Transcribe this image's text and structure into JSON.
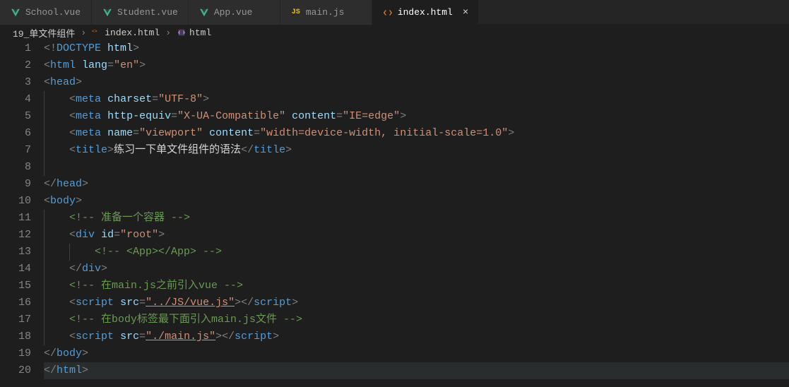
{
  "tabs": [
    {
      "label": "School.vue",
      "icon": "vue",
      "active": false
    },
    {
      "label": "Student.vue",
      "icon": "vue",
      "active": false
    },
    {
      "label": "App.vue",
      "icon": "vue",
      "active": false
    },
    {
      "label": "main.js",
      "icon": "js",
      "active": false
    },
    {
      "label": "index.html",
      "icon": "html",
      "active": true
    }
  ],
  "breadcrumb": {
    "folder": "19_单文件组件",
    "file": "index.html",
    "symbol": "html"
  },
  "close_label": "×",
  "icon_text": {
    "js": "JS"
  },
  "gutter_max": 20,
  "code_tokens": [
    [
      [
        "punct",
        "<!"
      ],
      [
        "tag",
        "DOCTYPE"
      ],
      [
        "text",
        " "
      ],
      [
        "attr",
        "html"
      ],
      [
        "punct",
        ">"
      ]
    ],
    [
      [
        "punct",
        "<"
      ],
      [
        "tag",
        "html"
      ],
      [
        "text",
        " "
      ],
      [
        "attr",
        "lang"
      ],
      [
        "punct",
        "="
      ],
      [
        "str",
        "\"en\""
      ],
      [
        "punct",
        ">"
      ]
    ],
    [
      [
        "punct",
        "<"
      ],
      [
        "tag",
        "head"
      ],
      [
        "punct",
        ">"
      ]
    ],
    [
      [
        "text",
        "    "
      ],
      [
        "punct",
        "<"
      ],
      [
        "tag",
        "meta"
      ],
      [
        "text",
        " "
      ],
      [
        "attr",
        "charset"
      ],
      [
        "punct",
        "="
      ],
      [
        "str",
        "\"UTF-8\""
      ],
      [
        "punct",
        ">"
      ]
    ],
    [
      [
        "text",
        "    "
      ],
      [
        "punct",
        "<"
      ],
      [
        "tag",
        "meta"
      ],
      [
        "text",
        " "
      ],
      [
        "attr",
        "http-equiv"
      ],
      [
        "punct",
        "="
      ],
      [
        "str",
        "\"X-UA-Compatible\""
      ],
      [
        "text",
        " "
      ],
      [
        "attr",
        "content"
      ],
      [
        "punct",
        "="
      ],
      [
        "str",
        "\"IE=edge\""
      ],
      [
        "punct",
        ">"
      ]
    ],
    [
      [
        "text",
        "    "
      ],
      [
        "punct",
        "<"
      ],
      [
        "tag",
        "meta"
      ],
      [
        "text",
        " "
      ],
      [
        "attr",
        "name"
      ],
      [
        "punct",
        "="
      ],
      [
        "str",
        "\"viewport\""
      ],
      [
        "text",
        " "
      ],
      [
        "attr",
        "content"
      ],
      [
        "punct",
        "="
      ],
      [
        "str",
        "\"width=device-width, initial-scale=1.0\""
      ],
      [
        "punct",
        ">"
      ]
    ],
    [
      [
        "text",
        "    "
      ],
      [
        "punct",
        "<"
      ],
      [
        "tag",
        "title"
      ],
      [
        "punct",
        ">"
      ],
      [
        "text",
        "练习一下单文件组件的语法"
      ],
      [
        "punct",
        "</"
      ],
      [
        "tag",
        "title"
      ],
      [
        "punct",
        ">"
      ]
    ],
    [],
    [
      [
        "punct",
        "</"
      ],
      [
        "tag",
        "head"
      ],
      [
        "punct",
        ">"
      ]
    ],
    [
      [
        "punct",
        "<"
      ],
      [
        "tag",
        "body"
      ],
      [
        "punct",
        ">"
      ]
    ],
    [
      [
        "text",
        "    "
      ],
      [
        "comment",
        "<!-- 准备一个容器 -->"
      ]
    ],
    [
      [
        "text",
        "    "
      ],
      [
        "punct",
        "<"
      ],
      [
        "tag",
        "div"
      ],
      [
        "text",
        " "
      ],
      [
        "attr",
        "id"
      ],
      [
        "punct",
        "="
      ],
      [
        "str",
        "\"root\""
      ],
      [
        "punct",
        ">"
      ]
    ],
    [
      [
        "text",
        "        "
      ],
      [
        "comment",
        "<!-- <App></App> -->"
      ]
    ],
    [
      [
        "text",
        "    "
      ],
      [
        "punct",
        "</"
      ],
      [
        "tag",
        "div"
      ],
      [
        "punct",
        ">"
      ]
    ],
    [
      [
        "text",
        "    "
      ],
      [
        "comment",
        "<!-- 在main.js之前引入vue -->"
      ]
    ],
    [
      [
        "text",
        "    "
      ],
      [
        "punct",
        "<"
      ],
      [
        "tag",
        "script"
      ],
      [
        "text",
        " "
      ],
      [
        "attr",
        "src"
      ],
      [
        "punct",
        "="
      ],
      [
        "str_u",
        "\"../JS/vue.js\""
      ],
      [
        "punct",
        "></"
      ],
      [
        "tag",
        "script"
      ],
      [
        "punct",
        ">"
      ]
    ],
    [
      [
        "text",
        "    "
      ],
      [
        "comment",
        "<!-- 在body标签最下面引入main.js文件 -->"
      ]
    ],
    [
      [
        "text",
        "    "
      ],
      [
        "punct",
        "<"
      ],
      [
        "tag",
        "script"
      ],
      [
        "text",
        " "
      ],
      [
        "attr",
        "src"
      ],
      [
        "punct",
        "="
      ],
      [
        "str_u",
        "\"./main.js\""
      ],
      [
        "punct",
        "></"
      ],
      [
        "tag",
        "script"
      ],
      [
        "punct",
        ">"
      ]
    ],
    [
      [
        "punct",
        "</"
      ],
      [
        "tag",
        "body"
      ],
      [
        "punct",
        ">"
      ]
    ],
    [
      [
        "punct",
        "</"
      ],
      [
        "tag",
        "html"
      ],
      [
        "punct",
        ">"
      ]
    ]
  ],
  "current_line": 20,
  "indent_guides": {
    "4": [
      0
    ],
    "5": [
      0
    ],
    "6": [
      0
    ],
    "7": [
      0
    ],
    "8": [
      0
    ],
    "11": [
      0
    ],
    "12": [
      0
    ],
    "13": [
      0,
      1
    ],
    "14": [
      0
    ],
    "15": [
      0
    ],
    "16": [
      0
    ],
    "17": [
      0
    ],
    "18": [
      0
    ]
  }
}
